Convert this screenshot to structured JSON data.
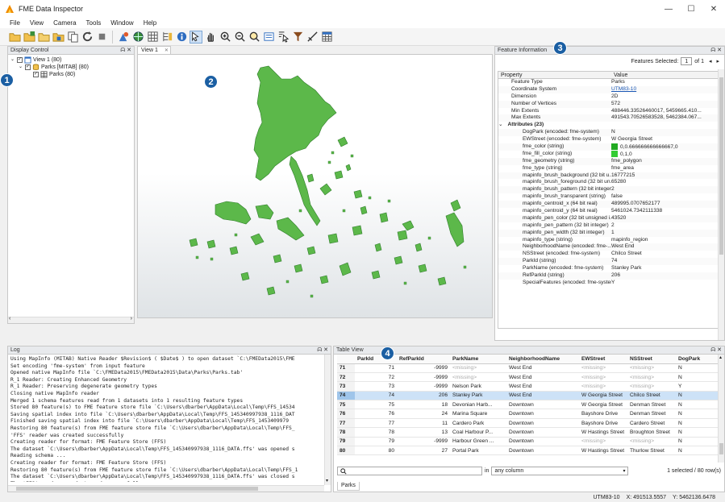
{
  "window": {
    "title": "FME Data Inspector",
    "minimize": "—",
    "maximize": "☐",
    "close": "✕"
  },
  "menu": [
    "File",
    "View",
    "Camera",
    "Tools",
    "Window",
    "Help"
  ],
  "callouts": [
    "1",
    "2",
    "3",
    "4"
  ],
  "display_control": {
    "title": "Display Control",
    "controls": "ᗣ ✕",
    "tree": [
      {
        "label": "View 1 (80)",
        "level": 0
      },
      {
        "label": "Parks [MITAB] (80)",
        "level": 1
      },
      {
        "label": "Parks (80)",
        "level": 2
      }
    ]
  },
  "view": {
    "tab_label": "View 1",
    "tab_close": "✕"
  },
  "feature_info": {
    "title": "Feature Information",
    "controls": "ᗣ ✕",
    "features_selected_label": "Features Selected:",
    "selected_index": "1",
    "of_label": "of 1",
    "col_property": "Property",
    "col_value": "Value",
    "rows": [
      {
        "p": "Feature Type",
        "v": "Parks"
      },
      {
        "p": "Coordinate System",
        "v": "UTM83-10",
        "link": true
      },
      {
        "p": "Dimension",
        "v": "2D"
      },
      {
        "p": "Number of Vertices",
        "v": "572"
      },
      {
        "p": "Min Extents",
        "v": "488446.33526460017, 5459665.410..."
      },
      {
        "p": "Max Extents",
        "v": "491543.70526583528, 5462384.067..."
      },
      {
        "p": "Attributes (23)",
        "v": "",
        "group": true
      },
      {
        "p": "DogPark (encoded: fme-system)",
        "v": "N",
        "sub": true
      },
      {
        "p": "EWStreet (encoded: fme-system)",
        "v": "W Georgia Street",
        "sub": true
      },
      {
        "p": "fme_color (string)",
        "v": "0,0.666666666666667,0",
        "sub": true,
        "swatch": "#22aa22"
      },
      {
        "p": "fme_fill_color (string)",
        "v": "0,1,0",
        "sub": true,
        "swatch": "#33cc33"
      },
      {
        "p": "fme_geometry (string)",
        "v": "fme_polygon",
        "sub": true
      },
      {
        "p": "fme_type (string)",
        "v": "fme_area",
        "sub": true
      },
      {
        "p": "mapinfo_brush_background (32 bit u...",
        "v": "16777215",
        "sub": true
      },
      {
        "p": "mapinfo_brush_foreground (32 bit un...",
        "v": "65280",
        "sub": true
      },
      {
        "p": "mapinfo_brush_pattern (32 bit integer)",
        "v": "2",
        "sub": true
      },
      {
        "p": "mapinfo_brush_transparent (string)",
        "v": "false",
        "sub": true
      },
      {
        "p": "mapinfo_centroid_x (64 bit real)",
        "v": "489995.0707652177",
        "sub": true
      },
      {
        "p": "mapinfo_centroid_y (64 bit real)",
        "v": "5461024.7342111338",
        "sub": true
      },
      {
        "p": "mapinfo_pen_color (32 bit unsigned i...",
        "v": "43520",
        "sub": true
      },
      {
        "p": "mapinfo_pen_pattern (32 bit integer)",
        "v": "2",
        "sub": true
      },
      {
        "p": "mapinfo_pen_width (32 bit integer)",
        "v": "1",
        "sub": true
      },
      {
        "p": "mapinfo_type (string)",
        "v": "mapinfo_region",
        "sub": true
      },
      {
        "p": "NeighborhoodName (encoded: fme-...",
        "v": "West End",
        "sub": true
      },
      {
        "p": "NSStreet (encoded: fme-system)",
        "v": "Chilco Street",
        "sub": true
      },
      {
        "p": "ParkId (string)",
        "v": "74",
        "sub": true
      },
      {
        "p": "ParkName (encoded: fme-system)",
        "v": "Stanley Park",
        "sub": true
      },
      {
        "p": "RefParkId (string)",
        "v": "206",
        "sub": true
      },
      {
        "p": "SpecialFeatures (encoded: fme-system)",
        "v": "Y",
        "sub": true
      }
    ]
  },
  "log": {
    "title": "Log",
    "controls": "ᗣ ✕",
    "lines": [
      "Using MapInfo (MITAB) Native Reader $Revision$ ( $Date$ ) to open dataset `C:\\FMEData2015\\FME",
      "Set encoding 'fme-system' from input feature",
      "Opened native MapInfo file `C:\\FMEData2015\\FMEData2015\\Data\\Parks\\Parks.tab'",
      "R_1 Reader: Creating Enhanced Geometry",
      "R_1 Reader: Preserving degenerate geometry types",
      "Closing native MapInfo reader",
      "Merged 1 schema features read from 1 datasets into 1 resulting feature types",
      "Stored 80 feature(s) to FME feature store file `C:\\Users\\dbarber\\AppData\\Local\\Temp\\FFS_14534",
      "Saving spatial index into file `C:\\Users\\dbarber\\AppData\\Local\\Temp\\FFS_145340997938_1116_DAT",
      "Finished saving spatial index into file `C:\\Users\\dbarber\\AppData\\Local\\Temp\\FFS_1453409979",
      "Restoring 80 feature(s) from FME feature store file `C:\\Users\\dbarber\\AppData\\Local\\Temp\\FFS_",
      "'FFS' reader was created successfully",
      "Creating reader for format: FME Feature Store (FFS)",
      "The dataset `C:\\Users\\dbarber\\AppData\\Local\\Temp\\FFS_145340997938_1116_DATA.ffs' was opened s",
      "Reading schema ...",
      "Creating reader for format: FME Feature Store (FFS)",
      "Restoring 80 feature(s) from FME feature store file `C:\\Users\\dbarber\\AppData\\Local\\Temp\\FFS_1",
      "The dataset `C:\\Users\\dbarber\\AppData\\Local\\Temp\\FFS_145340997938_1116_DATA.ffs' was closed s",
      "The 'FFS' reader was destroyed successfully"
    ]
  },
  "table_view": {
    "title": "Table View",
    "controls": "ᗣ ✕",
    "columns": [
      "",
      "ParkId",
      "RefParkId",
      "ParkName",
      "NeighborhoodName",
      "EWStreet",
      "NSStreet",
      "DogPark"
    ],
    "rows": [
      [
        "71",
        "71",
        "-9999",
        "<missing>",
        "West End",
        "<missing>",
        "<missing>",
        "N"
      ],
      [
        "72",
        "72",
        "-9999",
        "<missing>",
        "West End",
        "<missing>",
        "<missing>",
        "N"
      ],
      [
        "73",
        "73",
        "-9999",
        "Nelson Park",
        "West End",
        "<missing>",
        "<missing>",
        "Y"
      ],
      [
        "74",
        "74",
        "206",
        "Stanley Park",
        "West End",
        "W Georgia Street",
        "Chilco Street",
        "N"
      ],
      [
        "75",
        "75",
        "18",
        "Devonian Harb...",
        "Downtown",
        "W Georgia Street",
        "Denman Street",
        "N"
      ],
      [
        "76",
        "76",
        "24",
        "Marina Square",
        "Downtown",
        "Bayshore Drive",
        "Denman Street",
        "N"
      ],
      [
        "77",
        "77",
        "11",
        "Cardero Park",
        "Downtown",
        "Bayshore Drive",
        "Cardero Street",
        "N"
      ],
      [
        "78",
        "78",
        "13",
        "Coal Harbour P...",
        "Downtown",
        "W Hastings Street",
        "Broughton Street",
        "N"
      ],
      [
        "79",
        "79",
        "-9999",
        "Harbour Green ...",
        "Downtown",
        "<missing>",
        "<missing>",
        "N"
      ],
      [
        "80",
        "80",
        "27",
        "Portal Park",
        "Downtown",
        "W Hastings Street",
        "Thurlow Street",
        "N"
      ]
    ],
    "selected_row": "74",
    "search_placeholder": "",
    "in_label": "in",
    "column_combo": "any column",
    "selection_summary": "1 selected / 80 row(s)",
    "bottom_tab": "Parks"
  },
  "status": {
    "crs": "UTM83-10",
    "x_label": "X:",
    "x": "491513.5557",
    "y_label": "Y:",
    "y": "5462136.6478"
  },
  "colors": {
    "park_fill": "#5cb84a",
    "park_stroke": "#2f7d2a",
    "selection": "#cde2f7",
    "callout": "#1b5fa3",
    "link": "#1a57b5"
  }
}
